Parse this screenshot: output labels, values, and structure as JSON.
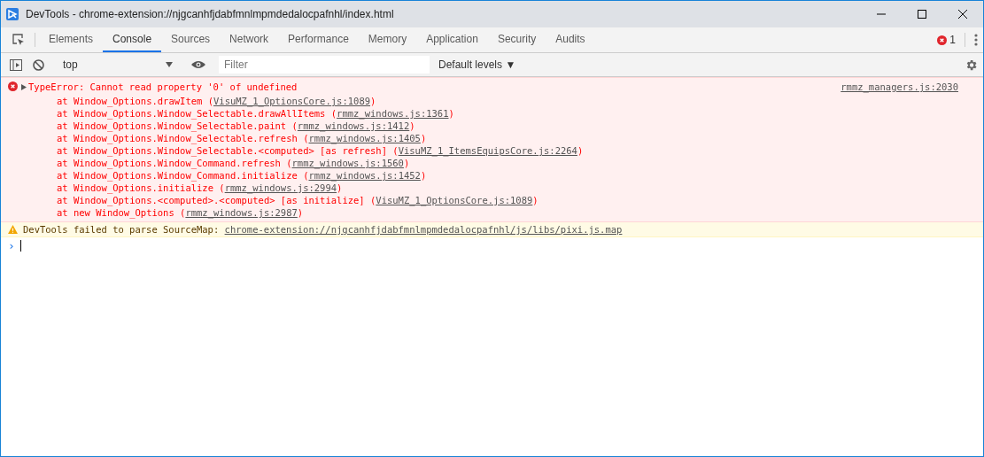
{
  "window": {
    "title": "DevTools - chrome-extension://njgcanhfjdabfmnlmpmdedalocpafnhl/index.html"
  },
  "tabs": [
    {
      "label": "Elements",
      "selected": false
    },
    {
      "label": "Console",
      "selected": true
    },
    {
      "label": "Sources",
      "selected": false
    },
    {
      "label": "Network",
      "selected": false
    },
    {
      "label": "Performance",
      "selected": false
    },
    {
      "label": "Memory",
      "selected": false
    },
    {
      "label": "Application",
      "selected": false
    },
    {
      "label": "Security",
      "selected": false
    },
    {
      "label": "Audits",
      "selected": false
    }
  ],
  "error_count": "1",
  "toolbar": {
    "context": "top",
    "filter": {
      "placeholder": "Filter"
    },
    "levels": "Default levels",
    "levels_caret": "▼"
  },
  "messages": [
    {
      "kind": "error",
      "expanded": false,
      "text": "TypeError: Cannot read property '0' of undefined",
      "source": "rmmz_managers.js:2030",
      "frames": [
        {
          "before": "at Window_Options.drawItem (",
          "link": "VisuMZ_1_OptionsCore.js:1089",
          "after": ")"
        },
        {
          "before": "at Window_Options.Window_Selectable.drawAllItems (",
          "link": "rmmz_windows.js:1361",
          "after": ")"
        },
        {
          "before": "at Window_Options.Window_Selectable.paint (",
          "link": "rmmz_windows.js:1412",
          "after": ")"
        },
        {
          "before": "at Window_Options.Window_Selectable.refresh (",
          "link": "rmmz_windows.js:1405",
          "after": ")"
        },
        {
          "before": "at Window_Options.Window_Selectable.<computed> [as refresh] (",
          "link": "VisuMZ_1_ItemsEquipsCore.js:2264",
          "after": ")"
        },
        {
          "before": "at Window_Options.Window_Command.refresh (",
          "link": "rmmz_windows.js:1560",
          "after": ")"
        },
        {
          "before": "at Window_Options.Window_Command.initialize (",
          "link": "rmmz_windows.js:1452",
          "after": ")"
        },
        {
          "before": "at Window_Options.initialize (",
          "link": "rmmz_windows.js:2994",
          "after": ")"
        },
        {
          "before": "at Window_Options.<computed>.<computed> [as initialize] (",
          "link": "VisuMZ_1_OptionsCore.js:1089",
          "after": ")"
        },
        {
          "before": "at new Window_Options (",
          "link": "rmmz_windows.js:2987",
          "after": ")"
        }
      ]
    },
    {
      "kind": "warning",
      "text": "DevTools failed to parse SourceMap: ",
      "link": "chrome-extension://njgcanhfjdabfmnlmpmdedalocpafnhl/js/libs/pixi.js.map"
    }
  ],
  "prompt": "›"
}
